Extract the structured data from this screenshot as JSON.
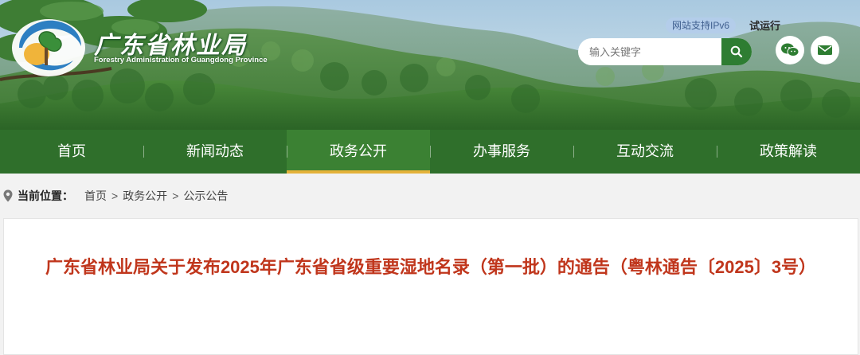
{
  "header": {
    "site_name": "广东省林业局",
    "site_name_en": "Forestry Administration of Guangdong Province",
    "ipv6_badge": "网站支持IPv6",
    "trial_run": "试运行",
    "search": {
      "placeholder": "输入关键字"
    },
    "social": [
      "wechat-icon",
      "mail-icon"
    ]
  },
  "nav": {
    "items": [
      {
        "label": "首页"
      },
      {
        "label": "新闻动态"
      },
      {
        "label": "政务公开",
        "active": true
      },
      {
        "label": "办事服务"
      },
      {
        "label": "互动交流"
      },
      {
        "label": "政策解读"
      }
    ]
  },
  "breadcrumb": {
    "label": "当前位置：",
    "items": [
      "首页",
      "政务公开",
      "公示公告"
    ],
    "separator": ">"
  },
  "article": {
    "title": "广东省林业局关于发布2025年广东省省级重要湿地名录（第一批）的通告（粤林通告〔2025〕3号）"
  },
  "colors": {
    "nav_bg": "#2f6f2b",
    "nav_active": "#3b8133",
    "nav_underline": "#e4b23a",
    "title_red": "#c0361c",
    "search_btn": "#2e7d32"
  }
}
